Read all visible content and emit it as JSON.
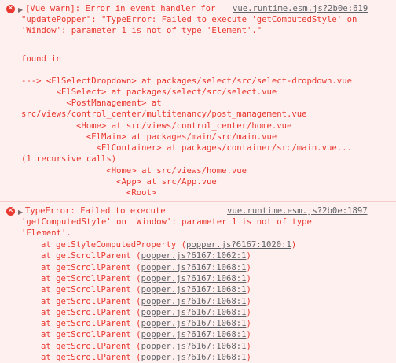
{
  "entry1": {
    "line1_prefix": "[Vue warn]: Error in event handler for ",
    "line1_link": "vue.runtime.esm.js?2b0e:619",
    "line2": "\"updatePopper\": \"TypeError: Failed to execute 'getComputedStyle' on",
    "line3": "'Window': parameter 1 is not of type 'Element'.\"",
    "found_in": "found in",
    "trace": [
      "---> <ElSelectDropdown> at packages/select/src/select-dropdown.vue",
      "       <ElSelect> at packages/select/src/select.vue",
      "         <PostManagement> at",
      "src/views/control_center/multitenancy/post_management.vue",
      "           <Home> at src/views/control_center/home.vue",
      "             <ElMain> at packages/main/src/main.vue",
      "               <ElContainer> at packages/container/src/main.vue...",
      "(1 recursive calls)",
      "                 <Home> at src/views/home.vue",
      "                   <App> at src/App.vue",
      "                     <Root>"
    ]
  },
  "entry2": {
    "line1_prefix": "TypeError: Failed to execute",
    "line1_link": "vue.runtime.esm.js?2b0e:1897",
    "line2": "'getComputedStyle' on 'Window': parameter 1 is not of type",
    "line3": "'Element'.",
    "stack": [
      {
        "func": "at getStyleComputedProperty (",
        "loc": "popper.js?6167:1020:1",
        "close": ")"
      },
      {
        "func": "at getScrollParent (",
        "loc": "popper.js?6167:1062:1",
        "close": ")"
      },
      {
        "func": "at getScrollParent (",
        "loc": "popper.js?6167:1068:1",
        "close": ")"
      },
      {
        "func": "at getScrollParent (",
        "loc": "popper.js?6167:1068:1",
        "close": ")"
      },
      {
        "func": "at getScrollParent (",
        "loc": "popper.js?6167:1068:1",
        "close": ")"
      },
      {
        "func": "at getScrollParent (",
        "loc": "popper.js?6167:1068:1",
        "close": ")"
      },
      {
        "func": "at getScrollParent (",
        "loc": "popper.js?6167:1068:1",
        "close": ")"
      },
      {
        "func": "at getScrollParent (",
        "loc": "popper.js?6167:1068:1",
        "close": ")"
      },
      {
        "func": "at getScrollParent (",
        "loc": "popper.js?6167:1068:1",
        "close": ")"
      },
      {
        "func": "at getScrollParent (",
        "loc": "popper.js?6167:1068:1",
        "close": ")"
      },
      {
        "func": "at getScrollParent (",
        "loc": "popper.js?6167:1068:1",
        "close": ")"
      }
    ]
  },
  "icons": {
    "error": "error-icon",
    "expand": "expand-triangle-icon"
  },
  "colors": {
    "text": "#e8382f",
    "background": "#fff0f0",
    "link": "#5f6368"
  }
}
